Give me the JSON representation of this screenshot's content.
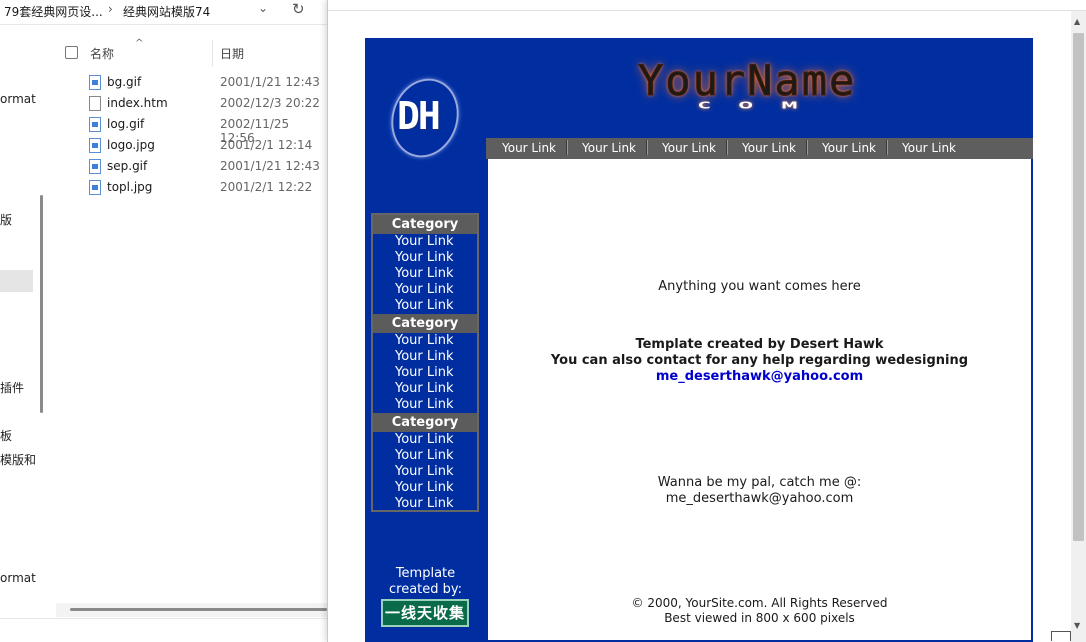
{
  "explorer": {
    "breadcrumb": [
      "79套经典网页设...",
      "经典网站模版74"
    ],
    "breadcrumb_sep": "›",
    "dropdown_glyph": "⌄",
    "refresh_glyph": "↻",
    "nav_items": [
      "ormat",
      "版",
      "插件",
      "板",
      "模版和",
      "ormat"
    ],
    "columns": {
      "name": "名称",
      "date": "日期"
    },
    "files": [
      {
        "name": "bg.gif",
        "date": "2001/1/21 12:43",
        "type": "image"
      },
      {
        "name": "index.htm",
        "date": "2002/12/3 20:22",
        "type": "htm"
      },
      {
        "name": "log.gif",
        "date": "2002/11/25 12:56",
        "type": "image"
      },
      {
        "name": "logo.jpg",
        "date": "2001/2/1 12:14",
        "type": "image"
      },
      {
        "name": "sep.gif",
        "date": "2001/1/21 12:43",
        "type": "image"
      },
      {
        "name": "topl.jpg",
        "date": "2001/2/1 12:22",
        "type": "image"
      }
    ]
  },
  "template": {
    "logo_text": "DH",
    "brand_name": "YourName",
    "brand_suffix": "COM",
    "top_links": [
      "Your Link",
      "Your Link",
      "Your Link",
      "Your Link",
      "Your Link",
      "Your Link"
    ],
    "categories": [
      {
        "title": "Category",
        "links": [
          "Your Link",
          "Your Link",
          "Your Link",
          "Your Link",
          "Your Link"
        ]
      },
      {
        "title": "Category",
        "links": [
          "Your Link",
          "Your Link",
          "Your Link",
          "Your Link",
          "Your Link"
        ]
      },
      {
        "title": "Category",
        "links": [
          "Your Link",
          "Your Link",
          "Your Link",
          "Your Link",
          "Your Link"
        ]
      }
    ],
    "content": {
      "intro": "Anything you want comes here",
      "credit_line": "Template created by Desert Hawk",
      "contact_line": "You can also contact for any help regarding wedesigning",
      "email_link": "me_deserthawk@yahoo.com",
      "pal_line": "Wanna be my pal, catch me @:",
      "pal_email": "me_deserthawk@yahoo.com",
      "copyright": "© 2000, YourSite.com. All Rights Reserved",
      "best_viewed": "Best viewed in 800 x 600 pixels"
    },
    "created_by_1": "Template",
    "created_by_2": "created by:",
    "badge": "一线天收集",
    "colors": {
      "page_bg": "#002ea0",
      "nav_gray": "#5e5e5e",
      "link_blue": "#0000cc",
      "badge_green": "#0a6b4a"
    }
  }
}
